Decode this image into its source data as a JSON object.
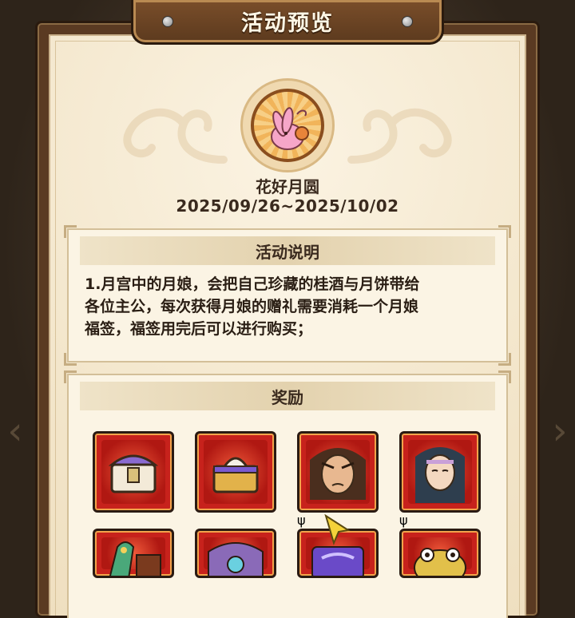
{
  "header": {
    "title": "活动预览"
  },
  "event": {
    "name": "花好月圆",
    "date_range": "2025/09/26~2025/10/02"
  },
  "description": {
    "heading": "活动说明",
    "text": "1.月宫中的月娘，会把自己珍藏的桂酒与月饼带给\n各位主公，每次获得月娘的赠礼需要消耗一个月娘\n福签，福签用完后可以进行购买；"
  },
  "rewards": {
    "heading": "奖励",
    "items": [
      {
        "icon": "white-chest-icon",
        "has_badge": false
      },
      {
        "icon": "gold-chest-icon",
        "has_badge": false
      },
      {
        "icon": "hero-portrait-warrior-icon",
        "has_badge": true
      },
      {
        "icon": "hero-portrait-scholar-icon",
        "has_badge": true
      },
      {
        "icon": "dragon-statue-icon",
        "has_badge": false
      },
      {
        "icon": "lotus-shrine-icon",
        "has_badge": false
      },
      {
        "icon": "purple-scroll-icon",
        "has_badge": false
      },
      {
        "icon": "golden-toad-icon",
        "has_badge": false
      }
    ]
  },
  "colors": {
    "reward_frame": "#c7221c",
    "panel_bg": "#f6ecd6",
    "title_plate": "#7a4e2a"
  }
}
